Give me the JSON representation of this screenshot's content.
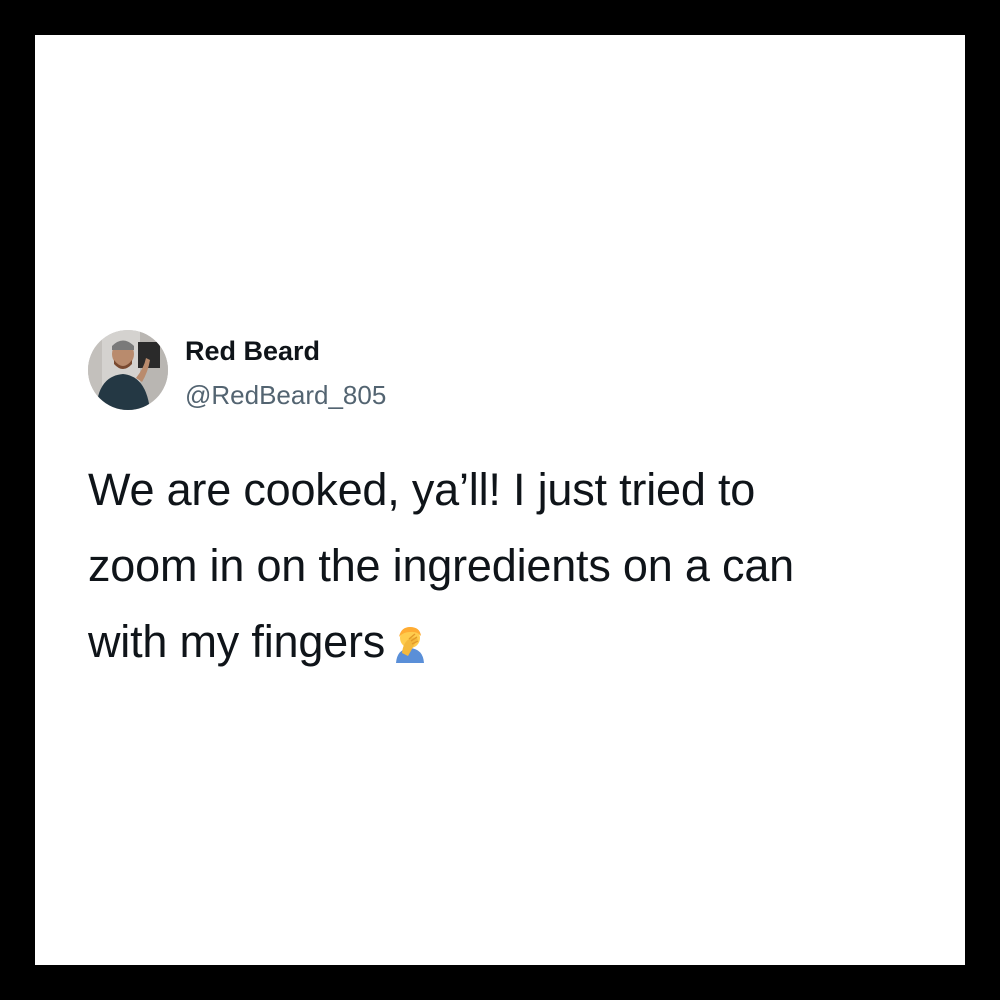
{
  "author": {
    "display_name": "Red Beard",
    "handle": "@RedBeard_805",
    "avatar_icon": "profile-photo-avatar"
  },
  "tweet": {
    "lines": [
      "We are cooked, ya’ll! I just tried to",
      "zoom in on the ingredients on a can",
      "with my fingers"
    ],
    "emoji_icon": "man-facepalming-emoji"
  },
  "colors": {
    "frame": "#000000",
    "card": "#ffffff",
    "text": "#0f1419",
    "handle": "#536471"
  }
}
